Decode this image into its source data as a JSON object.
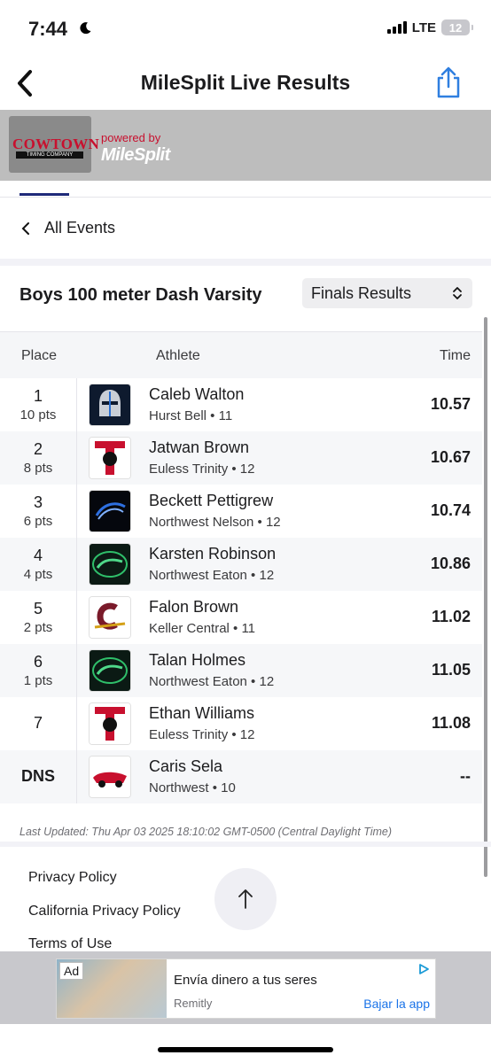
{
  "status_bar": {
    "time": "7:44",
    "network": "LTE",
    "battery": "12"
  },
  "nav": {
    "title": "MileSplit Live Results",
    "back_icon": "chevron-left-icon",
    "share_icon": "share-icon"
  },
  "sponsor": {
    "logo_title": "COWTOWN",
    "logo_subtitle": "TIMING COMPANY",
    "powered_by": "powered by",
    "brand": "MileSplit"
  },
  "breadcrumb": {
    "label": "All Events"
  },
  "event": {
    "title": "Boys 100 meter Dash Varsity",
    "results_select": "Finals Results"
  },
  "table": {
    "headers": {
      "place": "Place",
      "athlete": "Athlete",
      "time": "Time"
    },
    "rows": [
      {
        "place": "1",
        "pts": "10 pts",
        "name": "Caleb Walton",
        "team_year": "Hurst Bell • 11",
        "time": "10.57",
        "logo": "knight-logo-icon"
      },
      {
        "place": "2",
        "pts": "8 pts",
        "name": "Jatwan Brown",
        "team_year": "Euless Trinity • 12",
        "time": "10.67",
        "logo": "trojan-logo-icon"
      },
      {
        "place": "3",
        "pts": "6 pts",
        "name": "Beckett Pettigrew",
        "team_year": "Northwest Nelson • 12",
        "time": "10.74",
        "logo": "nelson-logo-icon"
      },
      {
        "place": "4",
        "pts": "4 pts",
        "name": "Karsten Robinson",
        "team_year": "Northwest Eaton • 12",
        "time": "10.86",
        "logo": "eagles-logo-icon"
      },
      {
        "place": "5",
        "pts": "2 pts",
        "name": "Falon Brown",
        "team_year": "Keller Central • 11",
        "time": "11.02",
        "logo": "central-logo-icon"
      },
      {
        "place": "6",
        "pts": "1 pts",
        "name": "Talan Holmes",
        "team_year": "Northwest Eaton • 12",
        "time": "11.05",
        "logo": "eagles-logo-icon"
      },
      {
        "place": "7",
        "pts": "",
        "name": "Ethan Williams",
        "team_year": "Euless Trinity • 12",
        "time": "11.08",
        "logo": "trojan-logo-icon"
      },
      {
        "place": "DNS",
        "pts": "",
        "name": "Caris Sela",
        "team_year": "Northwest • 10",
        "time": "--",
        "logo": "texans-logo-icon"
      }
    ]
  },
  "last_updated": "Last Updated: Thu Apr 03 2025 18:10:02 GMT-0500 (Central Daylight Time)",
  "footer": {
    "links": [
      "Privacy Policy",
      "California Privacy Policy",
      "Terms of Use"
    ]
  },
  "ad": {
    "badge": "Ad",
    "headline": "Envía dinero a tus seres",
    "brand": "Remitly",
    "cta": "Bajar la app"
  },
  "colors": {
    "accent": "#1f2a7a",
    "brand_red": "#c8102e",
    "link_blue": "#1a73e8"
  }
}
